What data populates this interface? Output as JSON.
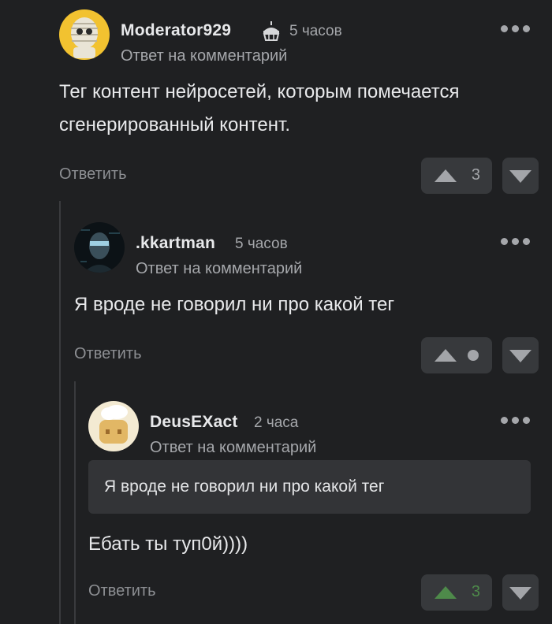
{
  "comments": [
    {
      "username": "Moderator929",
      "time": "5 часов",
      "reply_to": "Ответ на комментарий",
      "text": "Тег контент нейросетей, которым помечается сгенерированный контент.",
      "reply_label": "Ответить",
      "score": "3",
      "badge_icon": "cake-icon"
    },
    {
      "username": ".kkartman",
      "time": "5 часов",
      "reply_to": "Ответ на комментарий",
      "text": "Я вроде не говорил ни про какой тег",
      "reply_label": "Ответить",
      "score": null
    },
    {
      "username": "DeusEXact",
      "time": "2 часа",
      "reply_to": "Ответ на комментарий",
      "quote": "Я вроде не говорил ни про какой тег",
      "text": "Ебать ты туп0й))))",
      "reply_label": "Ответить",
      "score": "3"
    }
  ],
  "colors": {
    "background": "#1f2022",
    "vote_button": "#37393c",
    "positive": "#4e8a4a"
  }
}
